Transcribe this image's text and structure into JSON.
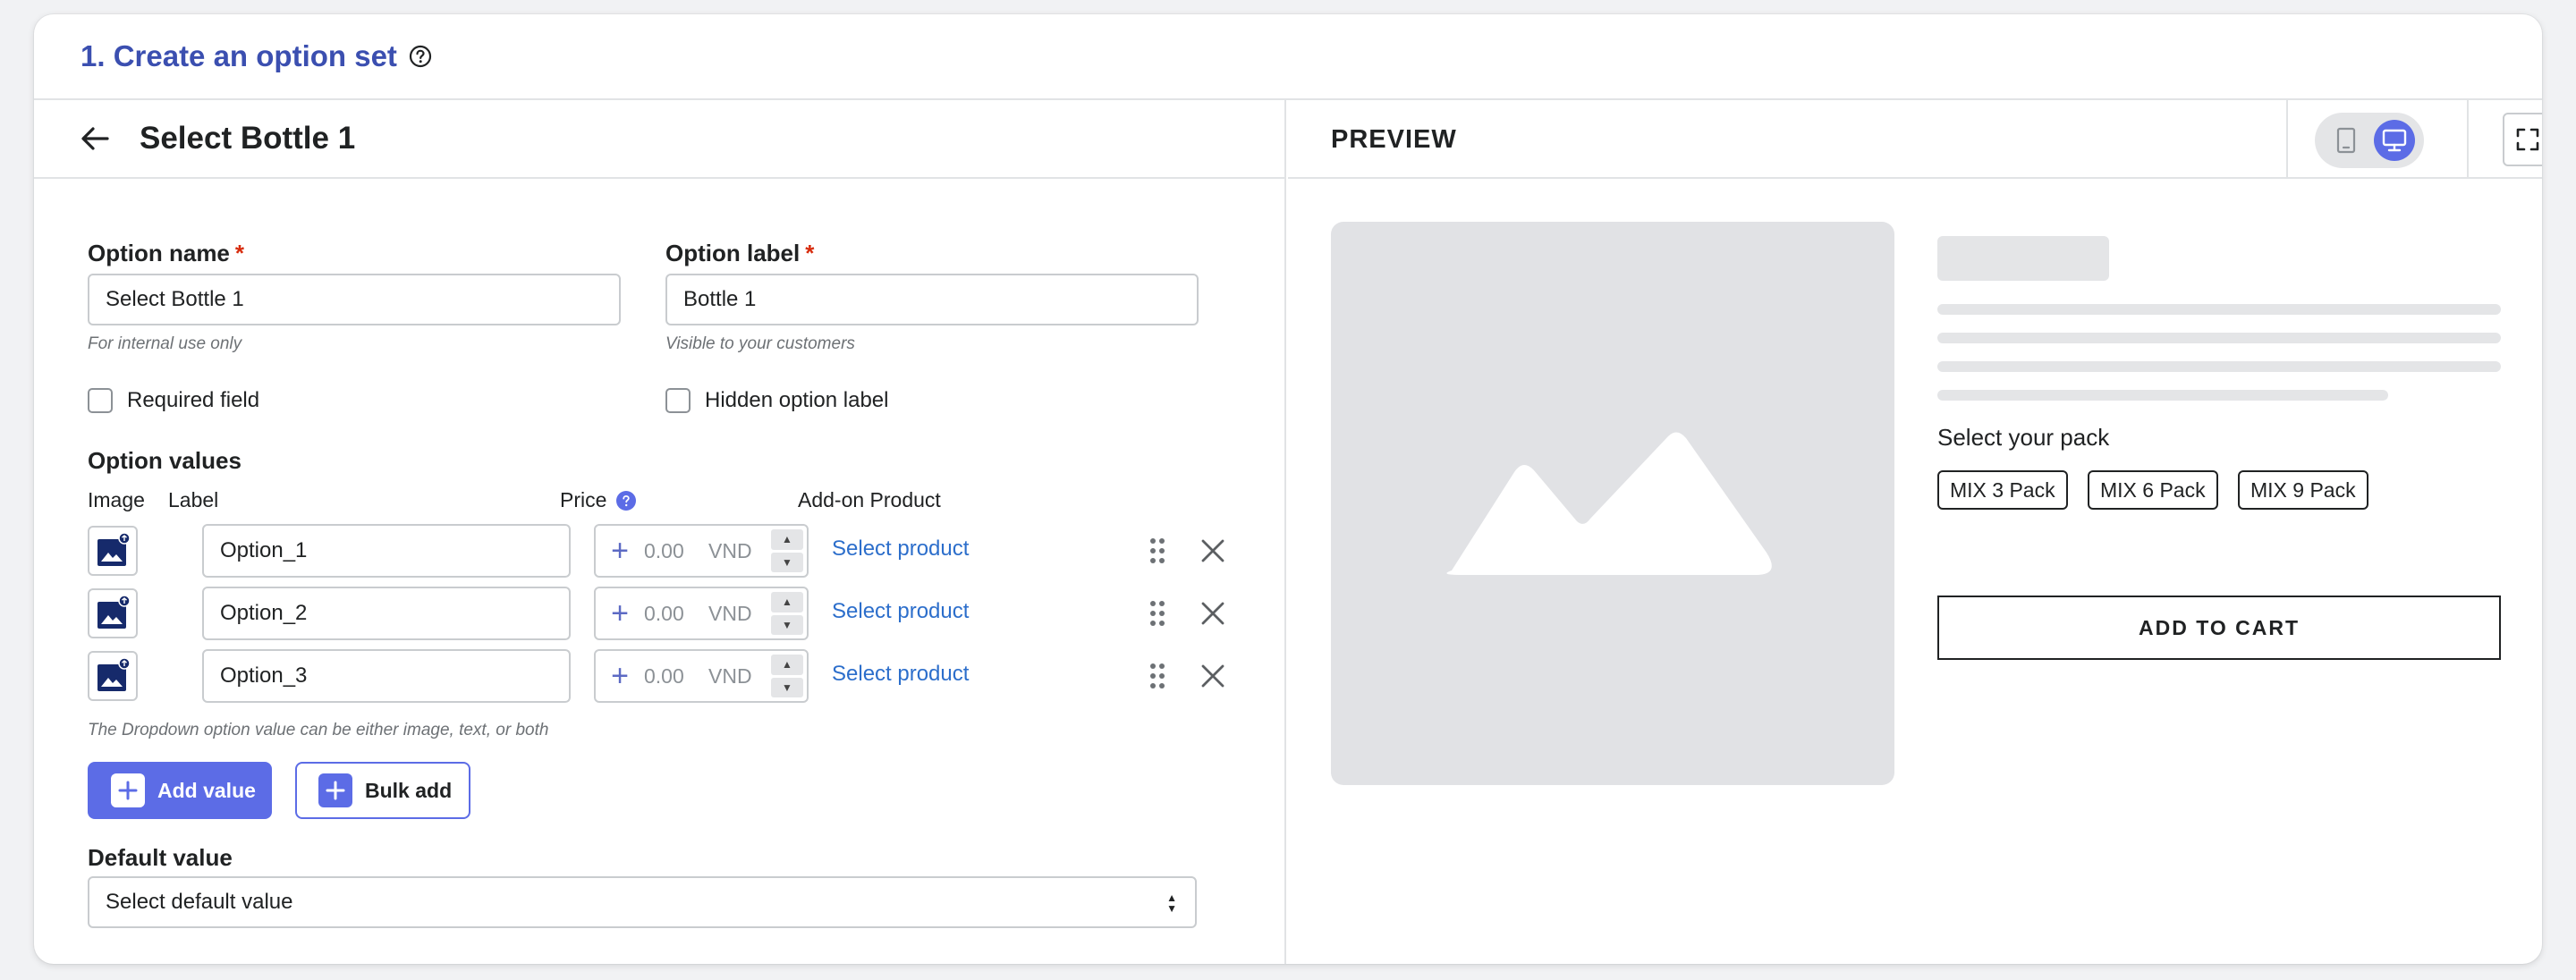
{
  "header": {
    "title": "1. Create an option set",
    "help_icon": "question-circle-icon"
  },
  "left_panel": {
    "title": "Select Bottle 1",
    "option_name": {
      "label": "Option name",
      "required_mark": "*",
      "value": "Select Bottle 1",
      "hint": "For internal use only"
    },
    "option_label": {
      "label": "Option label",
      "required_mark": "*",
      "value": "Bottle 1",
      "hint": "Visible to your customers"
    },
    "required_field": {
      "label": "Required field",
      "checked": false
    },
    "hidden_option_label": {
      "label": "Hidden option label",
      "checked": false
    },
    "option_values": {
      "title": "Option values",
      "columns": {
        "image": "Image",
        "label": "Label",
        "price": "Price",
        "addon": "Add-on Product"
      },
      "rows": [
        {
          "label": "Option_1",
          "price": "0.00",
          "currency": "VND",
          "addon_link": "Select product"
        },
        {
          "label": "Option_2",
          "price": "0.00",
          "currency": "VND",
          "addon_link": "Select product"
        },
        {
          "label": "Option_3",
          "price": "0.00",
          "currency": "VND",
          "addon_link": "Select product"
        }
      ],
      "hint": "The Dropdown option value can be either image, text, or both"
    },
    "buttons": {
      "add_value": "Add value",
      "bulk_add": "Bulk add"
    },
    "default_value": {
      "label": "Default value",
      "placeholder": "Select default value"
    }
  },
  "preview": {
    "title": "PREVIEW",
    "pack_label": "Select your pack",
    "packs": [
      "MIX 3 Pack",
      "MIX 6 Pack",
      "MIX 9 Pack"
    ],
    "add_to_cart": "ADD TO CART"
  },
  "colors": {
    "accent": "#5c6ce6",
    "title": "#3b4fb0",
    "link": "#2c6ecb",
    "required": "#d72c0d"
  }
}
